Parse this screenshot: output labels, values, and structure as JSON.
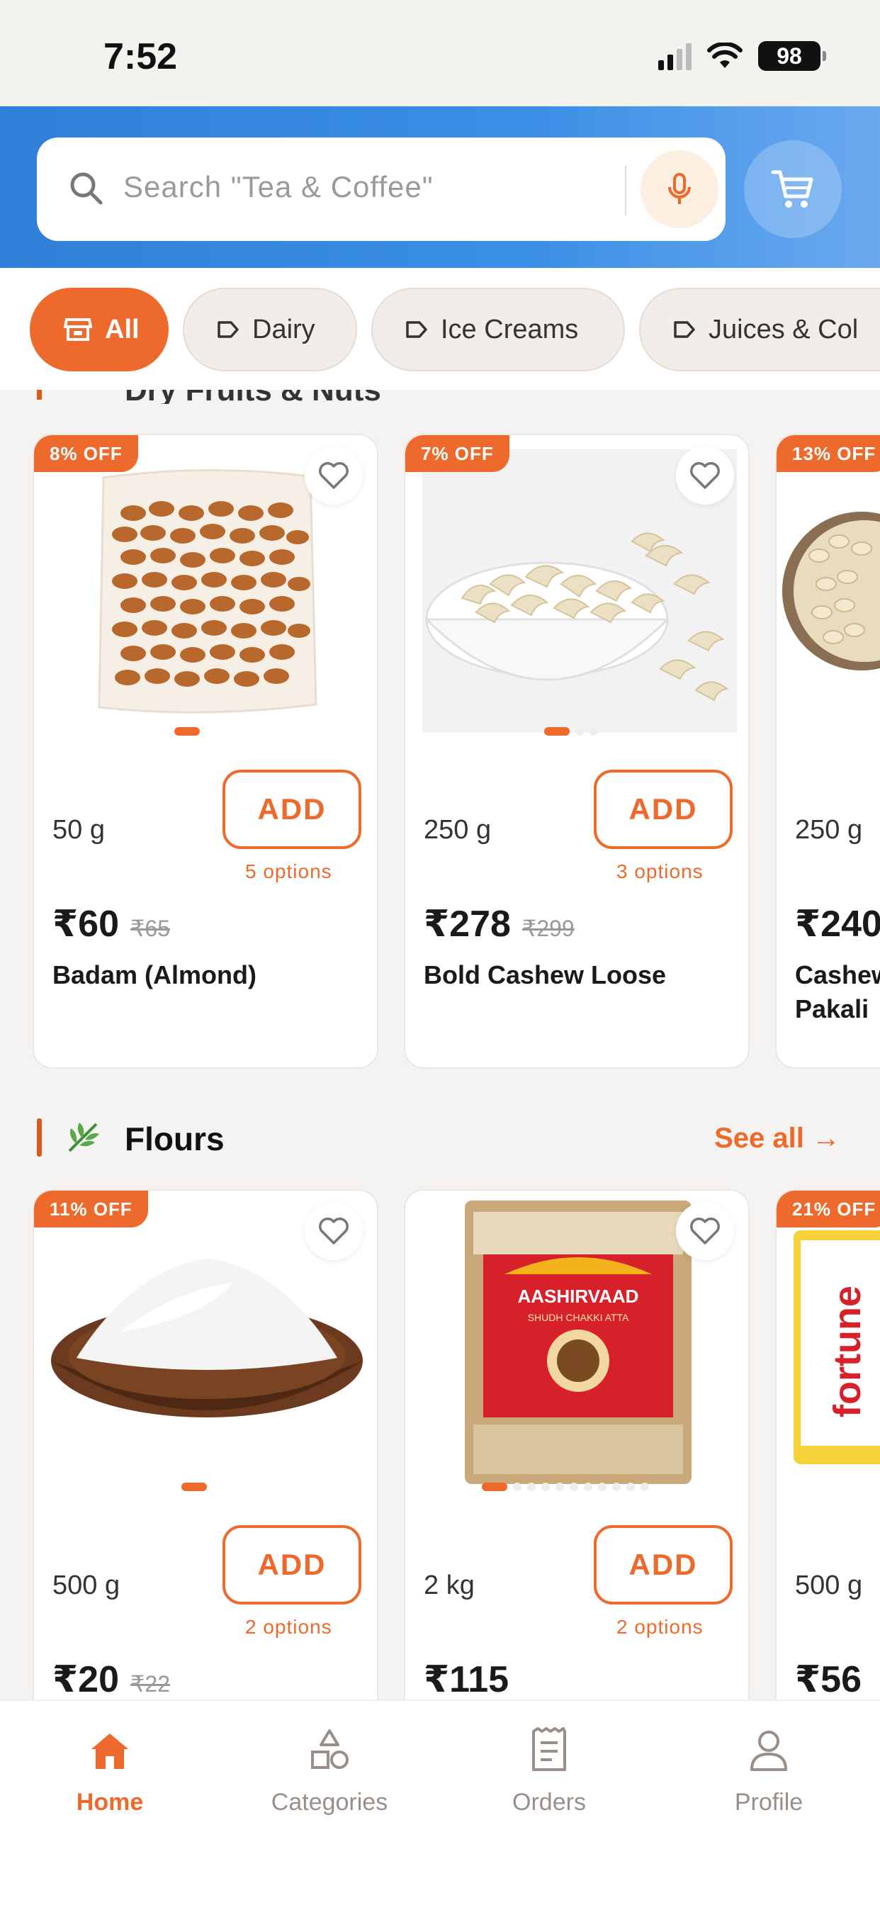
{
  "status_bar": {
    "time": "7:52",
    "battery": "98"
  },
  "search": {
    "placeholder": "Search \"Tea & Coffee\""
  },
  "categories": [
    {
      "label": "All",
      "active": true
    },
    {
      "label": "Dairy",
      "active": false
    },
    {
      "label": "Ice Creams",
      "active": false
    },
    {
      "label": "Juices & Col",
      "active": false
    }
  ],
  "section_dry_fruits": {
    "title": "Dry Fruits & Nuts"
  },
  "dry_fruits_products": [
    {
      "discount": "8% OFF",
      "weight": "50 g",
      "add_label": "ADD",
      "options": "5 options",
      "price": "₹60",
      "mrp": "₹65",
      "name": "Badam (Almond)"
    },
    {
      "discount": "7% OFF",
      "weight": "250 g",
      "add_label": "ADD",
      "options": "3 options",
      "price": "₹278",
      "mrp": "₹299",
      "name": "Bold Cashew Loose"
    },
    {
      "discount": "13% OFF",
      "weight": "250 g",
      "price": "₹240",
      "name": "Cashew Pakali"
    }
  ],
  "section_flours": {
    "title": "Flours",
    "see_all": "See all →"
  },
  "flours_products": [
    {
      "discount": "11% OFF",
      "weight": "500 g",
      "add_label": "ADD",
      "options": "2 options",
      "price": "₹20",
      "mrp": "₹22"
    },
    {
      "weight": "2 kg",
      "add_label": "ADD",
      "options": "2 options",
      "price": "₹115",
      "brand": "AASHIRVAAD",
      "brand_sub": "SHUDH CHAKKI ATTA"
    },
    {
      "discount": "21% OFF",
      "weight": "500 g",
      "price": "₹56",
      "brand": "fortune"
    }
  ],
  "bottom_nav": [
    {
      "label": "Home",
      "active": true,
      "icon": "home-icon"
    },
    {
      "label": "Categories",
      "active": false,
      "icon": "categories-icon"
    },
    {
      "label": "Orders",
      "active": false,
      "icon": "orders-icon"
    },
    {
      "label": "Profile",
      "active": false,
      "icon": "profile-icon"
    }
  ],
  "colors": {
    "accent": "#ee6a2c",
    "header_blue": "#2f7fd8"
  }
}
